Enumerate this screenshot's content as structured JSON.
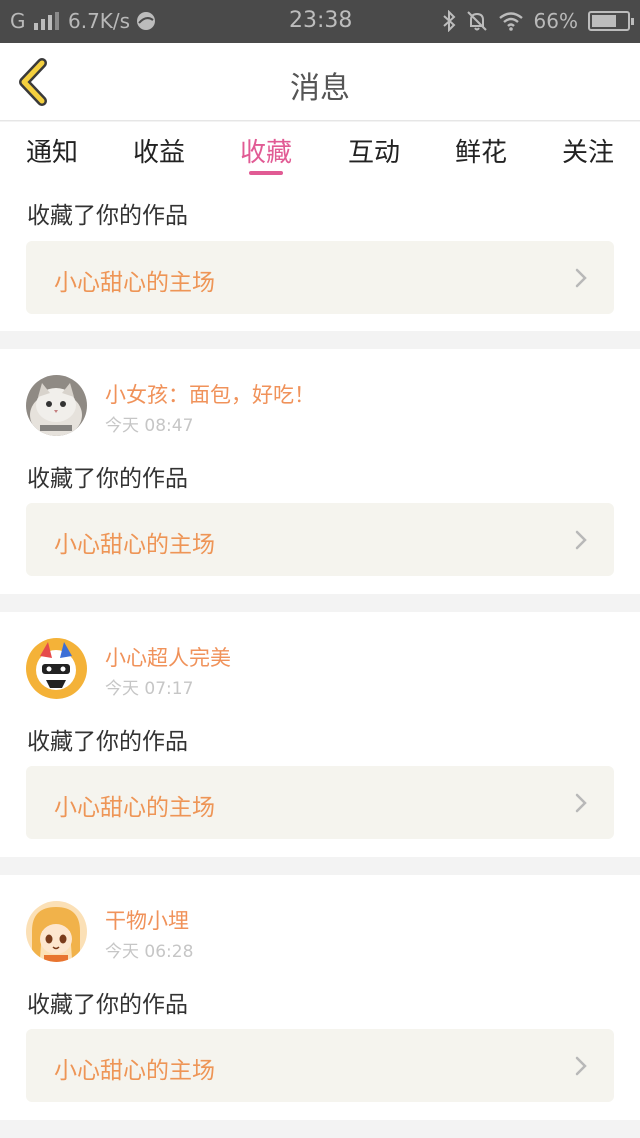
{
  "status_bar": {
    "signal": "G",
    "net_speed": "6.7K/s",
    "time": "23:38",
    "battery": "66%"
  },
  "header": {
    "title": "消息"
  },
  "tabs": [
    {
      "label": "通知"
    },
    {
      "label": "收益"
    },
    {
      "label": "收藏"
    },
    {
      "label": "互动"
    },
    {
      "label": "鲜花"
    },
    {
      "label": "关注"
    }
  ],
  "active_tab": "收藏",
  "colors": {
    "accent": "#e15b94",
    "name": "#f0925a",
    "work": "#ee9556"
  },
  "feed": [
    {
      "action": "收藏了你的作品",
      "work_title": "小心甜心的主场"
    },
    {
      "user": "小女孩：面包，好吃！",
      "time": "今天 08:47",
      "action": "收藏了你的作品",
      "work_title": "小心甜心的主场",
      "avatar": "cat-avatar"
    },
    {
      "user": "小心超人完美",
      "time": "今天 07:17",
      "action": "收藏了你的作品",
      "work_title": "小心甜心的主场",
      "avatar": "anime-mask-avatar"
    },
    {
      "user": "干物小埋",
      "time": "今天 06:28",
      "action": "收藏了你的作品",
      "work_title": "小心甜心的主场",
      "avatar": "umaru-avatar"
    }
  ]
}
